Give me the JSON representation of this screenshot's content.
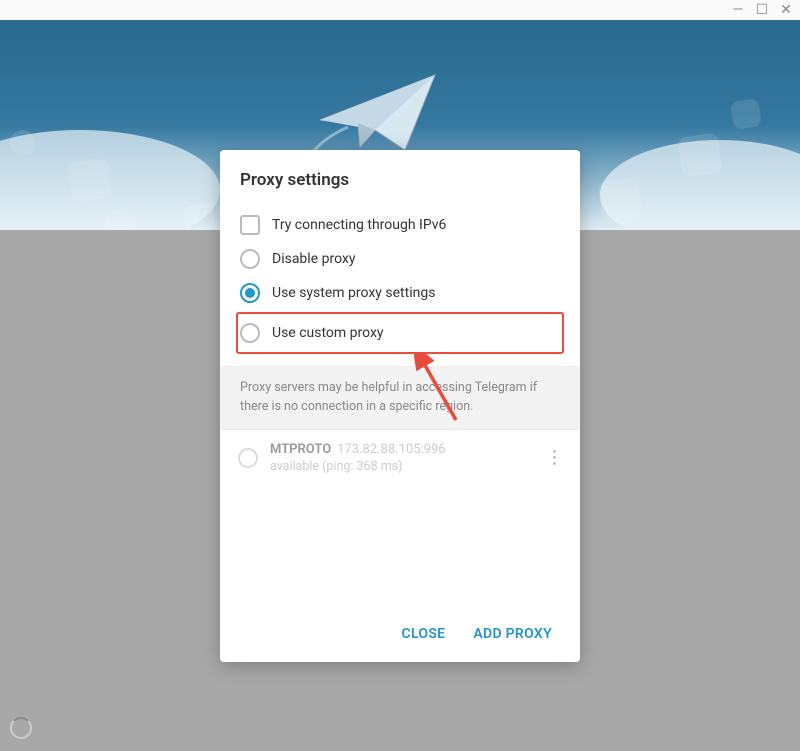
{
  "dialog": {
    "title": "Proxy settings",
    "ipv6_label": "Try connecting through IPv6",
    "disable_label": "Disable proxy",
    "system_label": "Use system proxy settings",
    "custom_label": "Use custom proxy",
    "info_text": "Proxy servers may be helpful in accessing Telegram if there is no connection in a specific region.",
    "proxy": {
      "type": "MTPROTO",
      "address": "173.82.88.105:996",
      "status": "available (ping: 368 ms)"
    },
    "actions": {
      "close": "CLOSE",
      "add": "ADD PROXY"
    }
  }
}
